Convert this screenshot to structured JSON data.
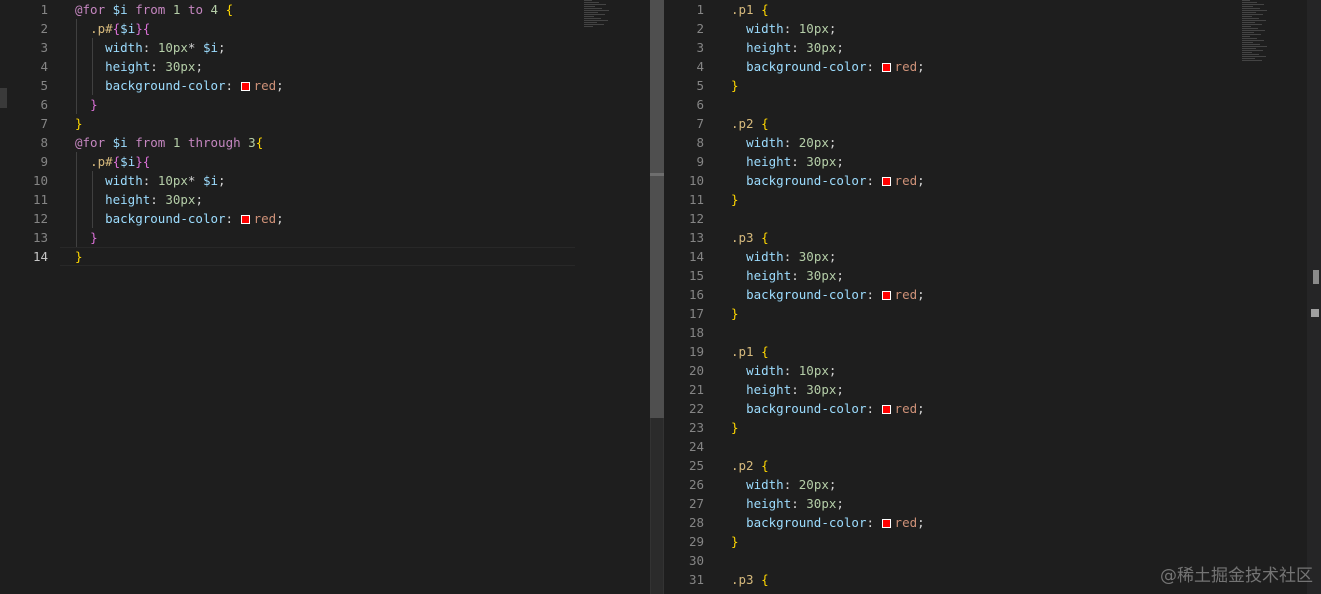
{
  "left_editor": {
    "lines": [
      {
        "n": "1",
        "tokens": [
          [
            "kw",
            "@for"
          ],
          [
            "plain",
            " "
          ],
          [
            "var",
            "$i"
          ],
          [
            "plain",
            " "
          ],
          [
            "kw",
            "from"
          ],
          [
            "plain",
            " "
          ],
          [
            "num",
            "1"
          ],
          [
            "plain",
            " "
          ],
          [
            "kw",
            "to"
          ],
          [
            "plain",
            " "
          ],
          [
            "num",
            "4"
          ],
          [
            "plain",
            " "
          ],
          [
            "b1",
            "{"
          ]
        ]
      },
      {
        "n": "2",
        "tokens": [
          [
            "plain",
            "  "
          ],
          [
            "sel",
            ".p#"
          ],
          [
            "b2",
            "{"
          ],
          [
            "var",
            "$i"
          ],
          [
            "b2",
            "}{"
          ]
        ]
      },
      {
        "n": "3",
        "tokens": [
          [
            "plain",
            "    "
          ],
          [
            "prop",
            "width"
          ],
          [
            "plain",
            ": "
          ],
          [
            "num",
            "10px"
          ],
          [
            "plain",
            "* "
          ],
          [
            "var",
            "$i"
          ],
          [
            "plain",
            ";"
          ]
        ]
      },
      {
        "n": "4",
        "tokens": [
          [
            "plain",
            "    "
          ],
          [
            "prop",
            "height"
          ],
          [
            "plain",
            ": "
          ],
          [
            "num",
            "30px"
          ],
          [
            "plain",
            ";"
          ]
        ]
      },
      {
        "n": "5",
        "tokens": [
          [
            "plain",
            "    "
          ],
          [
            "prop",
            "background-color"
          ],
          [
            "plain",
            ": "
          ],
          [
            "swatch",
            ""
          ],
          [
            "val",
            "red"
          ],
          [
            "plain",
            ";"
          ]
        ]
      },
      {
        "n": "6",
        "tokens": [
          [
            "plain",
            "  "
          ],
          [
            "b2",
            "}"
          ]
        ]
      },
      {
        "n": "7",
        "tokens": [
          [
            "b1",
            "}"
          ]
        ]
      },
      {
        "n": "8",
        "tokens": [
          [
            "kw",
            "@for"
          ],
          [
            "plain",
            " "
          ],
          [
            "var",
            "$i"
          ],
          [
            "plain",
            " "
          ],
          [
            "kw",
            "from"
          ],
          [
            "plain",
            " "
          ],
          [
            "num",
            "1"
          ],
          [
            "plain",
            " "
          ],
          [
            "kw",
            "through"
          ],
          [
            "plain",
            " "
          ],
          [
            "num",
            "3"
          ],
          [
            "b1",
            "{"
          ]
        ]
      },
      {
        "n": "9",
        "tokens": [
          [
            "plain",
            "  "
          ],
          [
            "sel",
            ".p#"
          ],
          [
            "b2",
            "{"
          ],
          [
            "var",
            "$i"
          ],
          [
            "b2",
            "}{"
          ]
        ]
      },
      {
        "n": "10",
        "tokens": [
          [
            "plain",
            "    "
          ],
          [
            "prop",
            "width"
          ],
          [
            "plain",
            ": "
          ],
          [
            "num",
            "10px"
          ],
          [
            "plain",
            "* "
          ],
          [
            "var",
            "$i"
          ],
          [
            "plain",
            ";"
          ]
        ]
      },
      {
        "n": "11",
        "tokens": [
          [
            "plain",
            "    "
          ],
          [
            "prop",
            "height"
          ],
          [
            "plain",
            ": "
          ],
          [
            "num",
            "30px"
          ],
          [
            "plain",
            ";"
          ]
        ]
      },
      {
        "n": "12",
        "tokens": [
          [
            "plain",
            "    "
          ],
          [
            "prop",
            "background-color"
          ],
          [
            "plain",
            ": "
          ],
          [
            "swatch",
            ""
          ],
          [
            "val",
            "red"
          ],
          [
            "plain",
            ";"
          ]
        ]
      },
      {
        "n": "13",
        "tokens": [
          [
            "plain",
            "  "
          ],
          [
            "b2",
            "}"
          ]
        ]
      },
      {
        "n": "14",
        "active": true,
        "tokens": [
          [
            "b1",
            "}"
          ]
        ]
      }
    ]
  },
  "right_editor": {
    "lines": [
      {
        "n": "1",
        "tokens": [
          [
            "sel",
            ".p1"
          ],
          [
            "plain",
            " "
          ],
          [
            "b1",
            "{"
          ]
        ]
      },
      {
        "n": "2",
        "tokens": [
          [
            "plain",
            "  "
          ],
          [
            "prop",
            "width"
          ],
          [
            "plain",
            ": "
          ],
          [
            "num",
            "10px"
          ],
          [
            "plain",
            ";"
          ]
        ]
      },
      {
        "n": "3",
        "tokens": [
          [
            "plain",
            "  "
          ],
          [
            "prop",
            "height"
          ],
          [
            "plain",
            ": "
          ],
          [
            "num",
            "30px"
          ],
          [
            "plain",
            ";"
          ]
        ]
      },
      {
        "n": "4",
        "tokens": [
          [
            "plain",
            "  "
          ],
          [
            "prop",
            "background-color"
          ],
          [
            "plain",
            ": "
          ],
          [
            "swatch",
            ""
          ],
          [
            "val",
            "red"
          ],
          [
            "plain",
            ";"
          ]
        ]
      },
      {
        "n": "5",
        "tokens": [
          [
            "b1",
            "}"
          ]
        ]
      },
      {
        "n": "6",
        "tokens": []
      },
      {
        "n": "7",
        "tokens": [
          [
            "sel",
            ".p2"
          ],
          [
            "plain",
            " "
          ],
          [
            "b1",
            "{"
          ]
        ]
      },
      {
        "n": "8",
        "tokens": [
          [
            "plain",
            "  "
          ],
          [
            "prop",
            "width"
          ],
          [
            "plain",
            ": "
          ],
          [
            "num",
            "20px"
          ],
          [
            "plain",
            ";"
          ]
        ]
      },
      {
        "n": "9",
        "tokens": [
          [
            "plain",
            "  "
          ],
          [
            "prop",
            "height"
          ],
          [
            "plain",
            ": "
          ],
          [
            "num",
            "30px"
          ],
          [
            "plain",
            ";"
          ]
        ]
      },
      {
        "n": "10",
        "tokens": [
          [
            "plain",
            "  "
          ],
          [
            "prop",
            "background-color"
          ],
          [
            "plain",
            ": "
          ],
          [
            "swatch",
            ""
          ],
          [
            "val",
            "red"
          ],
          [
            "plain",
            ";"
          ]
        ]
      },
      {
        "n": "11",
        "tokens": [
          [
            "b1",
            "}"
          ]
        ]
      },
      {
        "n": "12",
        "tokens": []
      },
      {
        "n": "13",
        "tokens": [
          [
            "sel",
            ".p3"
          ],
          [
            "plain",
            " "
          ],
          [
            "b1",
            "{"
          ]
        ]
      },
      {
        "n": "14",
        "tokens": [
          [
            "plain",
            "  "
          ],
          [
            "prop",
            "width"
          ],
          [
            "plain",
            ": "
          ],
          [
            "num",
            "30px"
          ],
          [
            "plain",
            ";"
          ]
        ]
      },
      {
        "n": "15",
        "tokens": [
          [
            "plain",
            "  "
          ],
          [
            "prop",
            "height"
          ],
          [
            "plain",
            ": "
          ],
          [
            "num",
            "30px"
          ],
          [
            "plain",
            ";"
          ]
        ]
      },
      {
        "n": "16",
        "tokens": [
          [
            "plain",
            "  "
          ],
          [
            "prop",
            "background-color"
          ],
          [
            "plain",
            ": "
          ],
          [
            "swatch",
            ""
          ],
          [
            "val",
            "red"
          ],
          [
            "plain",
            ";"
          ]
        ]
      },
      {
        "n": "17",
        "tokens": [
          [
            "b1",
            "}"
          ]
        ]
      },
      {
        "n": "18",
        "tokens": []
      },
      {
        "n": "19",
        "tokens": [
          [
            "sel",
            ".p1"
          ],
          [
            "plain",
            " "
          ],
          [
            "b1",
            "{"
          ]
        ]
      },
      {
        "n": "20",
        "tokens": [
          [
            "plain",
            "  "
          ],
          [
            "prop",
            "width"
          ],
          [
            "plain",
            ": "
          ],
          [
            "num",
            "10px"
          ],
          [
            "plain",
            ";"
          ]
        ]
      },
      {
        "n": "21",
        "tokens": [
          [
            "plain",
            "  "
          ],
          [
            "prop",
            "height"
          ],
          [
            "plain",
            ": "
          ],
          [
            "num",
            "30px"
          ],
          [
            "plain",
            ";"
          ]
        ]
      },
      {
        "n": "22",
        "tokens": [
          [
            "plain",
            "  "
          ],
          [
            "prop",
            "background-color"
          ],
          [
            "plain",
            ": "
          ],
          [
            "swatch",
            ""
          ],
          [
            "val",
            "red"
          ],
          [
            "plain",
            ";"
          ]
        ]
      },
      {
        "n": "23",
        "tokens": [
          [
            "b1",
            "}"
          ]
        ]
      },
      {
        "n": "24",
        "tokens": []
      },
      {
        "n": "25",
        "tokens": [
          [
            "sel",
            ".p2"
          ],
          [
            "plain",
            " "
          ],
          [
            "b1",
            "{"
          ]
        ]
      },
      {
        "n": "26",
        "tokens": [
          [
            "plain",
            "  "
          ],
          [
            "prop",
            "width"
          ],
          [
            "plain",
            ": "
          ],
          [
            "num",
            "20px"
          ],
          [
            "plain",
            ";"
          ]
        ]
      },
      {
        "n": "27",
        "tokens": [
          [
            "plain",
            "  "
          ],
          [
            "prop",
            "height"
          ],
          [
            "plain",
            ": "
          ],
          [
            "num",
            "30px"
          ],
          [
            "plain",
            ";"
          ]
        ]
      },
      {
        "n": "28",
        "tokens": [
          [
            "plain",
            "  "
          ],
          [
            "prop",
            "background-color"
          ],
          [
            "plain",
            ": "
          ],
          [
            "swatch",
            ""
          ],
          [
            "val",
            "red"
          ],
          [
            "plain",
            ";"
          ]
        ]
      },
      {
        "n": "29",
        "tokens": [
          [
            "b1",
            "}"
          ]
        ]
      },
      {
        "n": "30",
        "tokens": []
      },
      {
        "n": "31",
        "tokens": [
          [
            "sel",
            ".p3"
          ],
          [
            "plain",
            " "
          ],
          [
            "b1",
            "{"
          ]
        ]
      }
    ]
  },
  "swatch_color": "#ff0000",
  "watermark": "@稀土掘金技术社区"
}
